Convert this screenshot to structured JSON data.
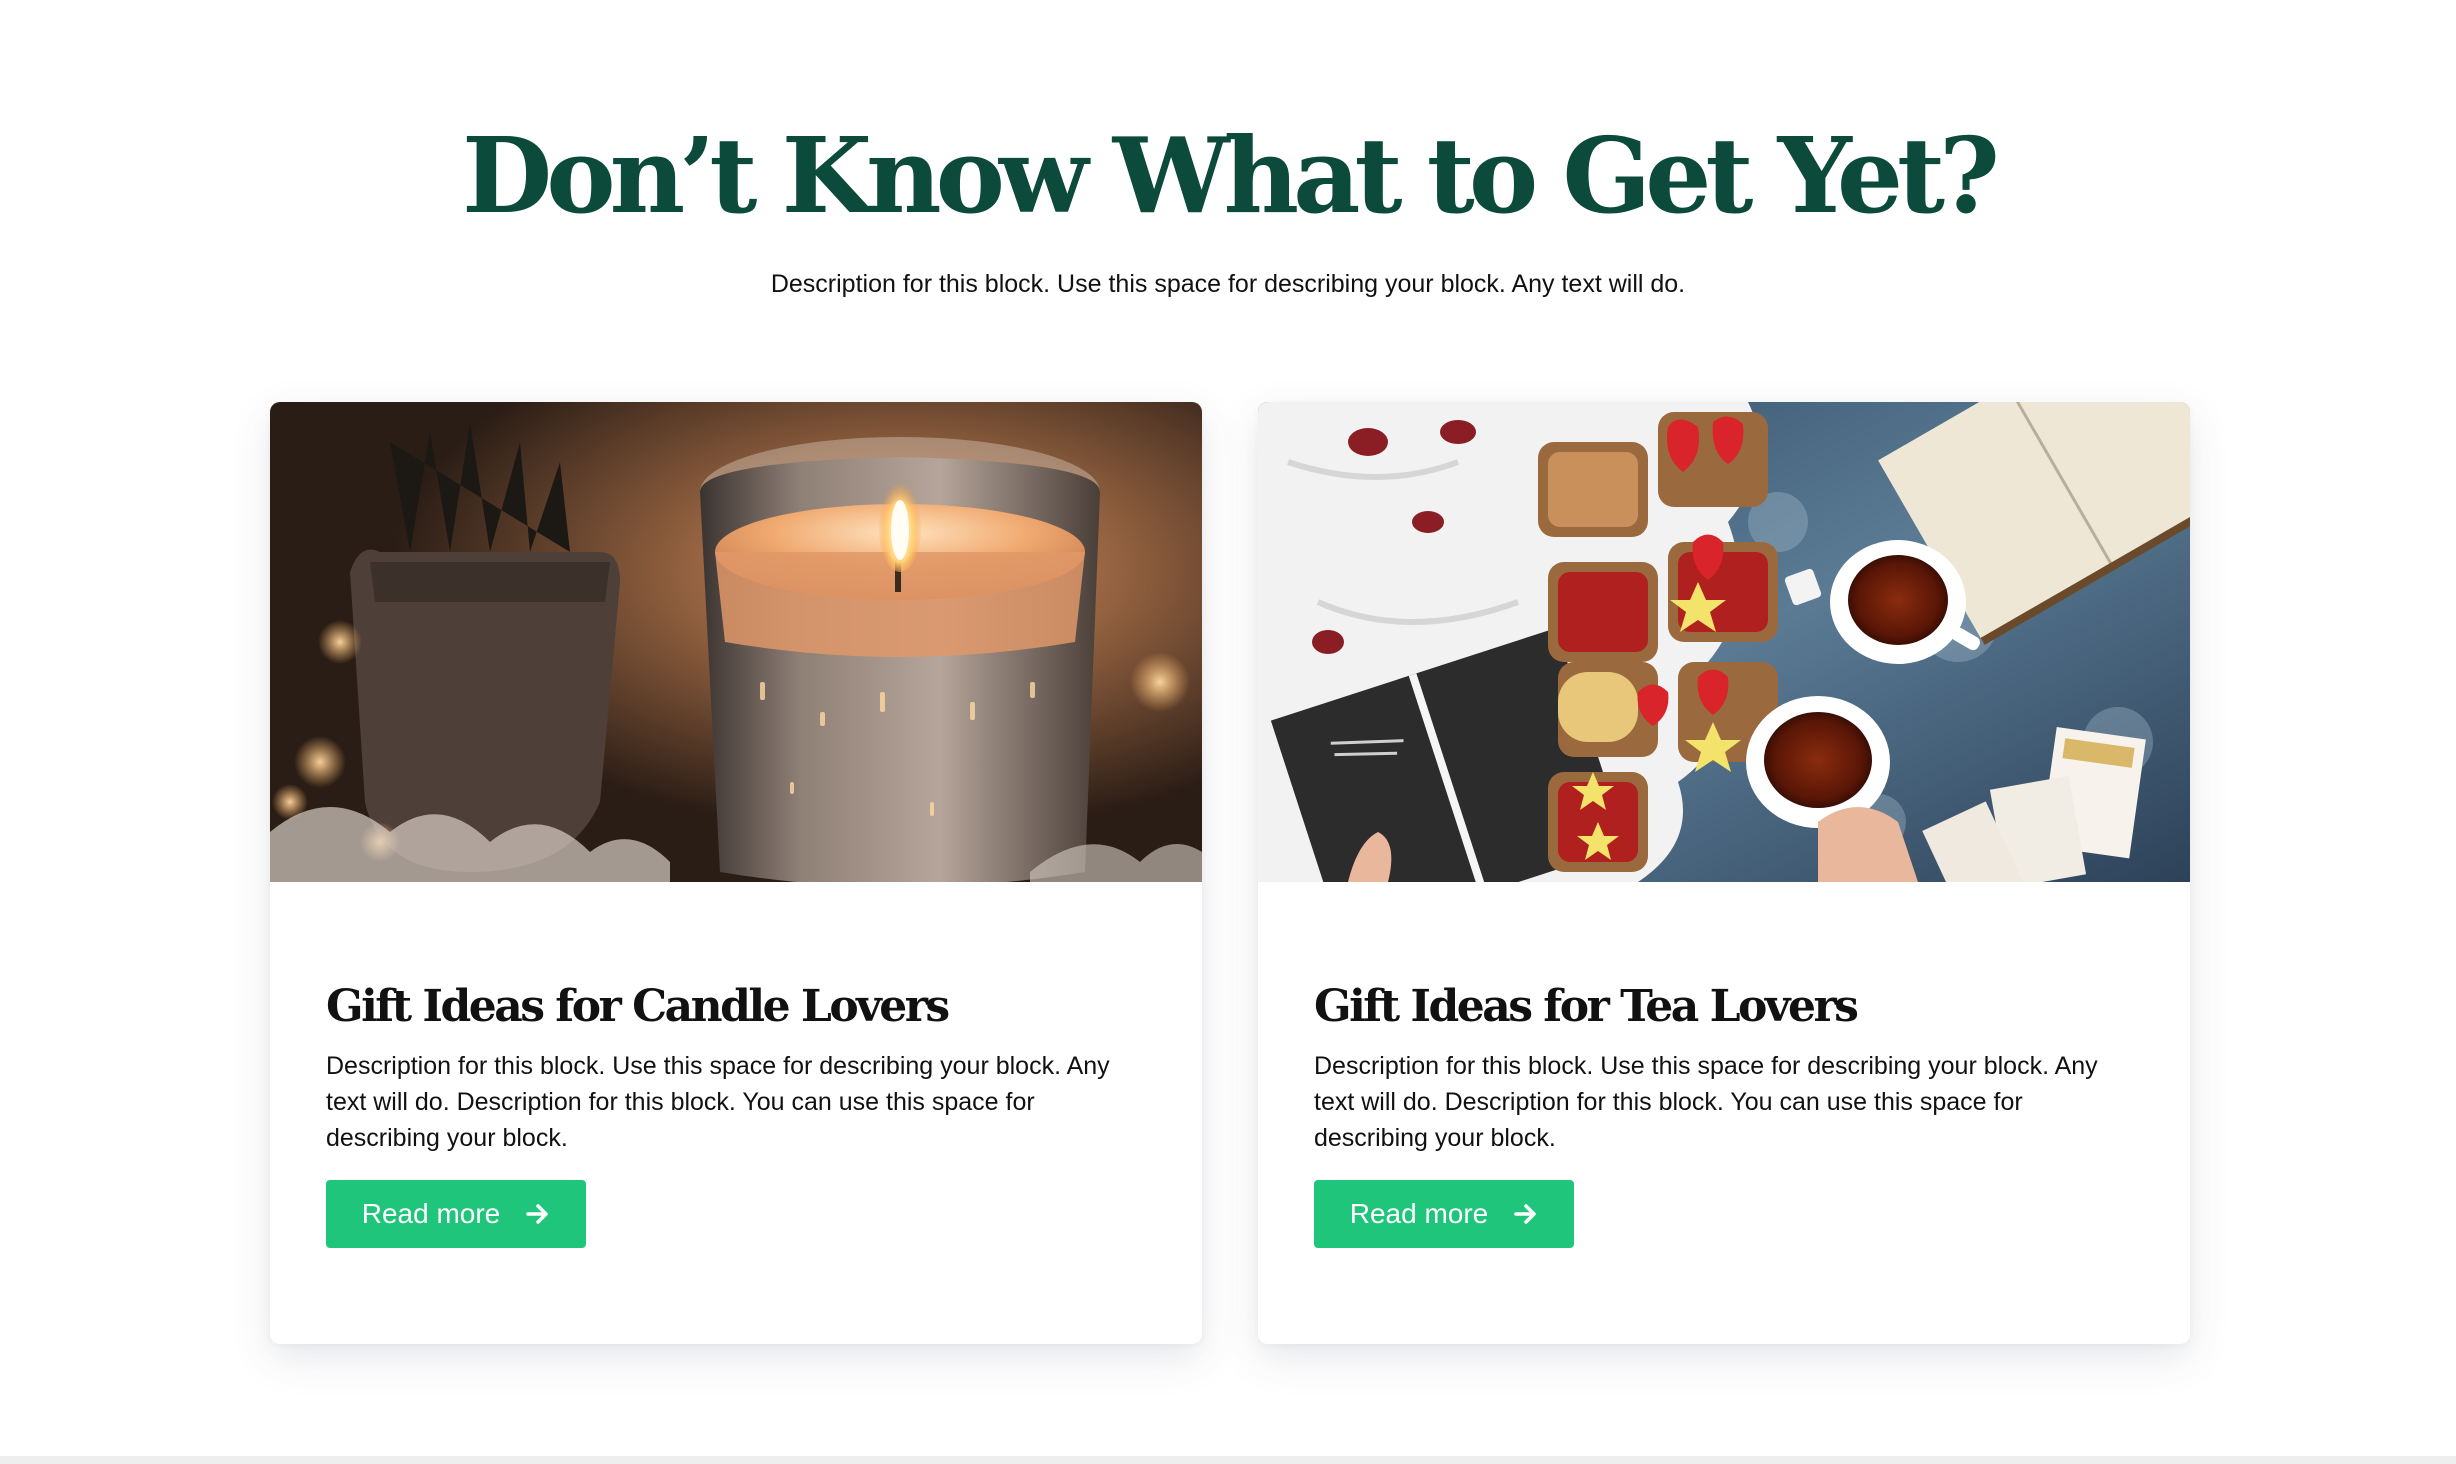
{
  "section": {
    "title": "Don’t Know What to Get Yet?",
    "description": "Description for this block. Use this space for describing your block. Any text will do."
  },
  "cards": [
    {
      "title": "Gift Ideas for Candle Lovers",
      "description": "Description for this block. Use this space for describing your block. Any text will do. Description for this block. You can use this space for describing your block.",
      "button_label": "Read more",
      "button_icon": "arrow-right-icon",
      "image": "lit-candle-photo"
    },
    {
      "title": "Gift Ideas for Tea Lovers",
      "description": "Description for this block. Use this space for describing your block. Any text will do. Description for this block. You can use this space for describing your block.",
      "button_label": "Read more",
      "button_icon": "arrow-right-icon",
      "image": "tea-and-toast-flatlay-photo"
    }
  ],
  "colors": {
    "heading": "#0c4a3c",
    "button": "#20c57c",
    "text": "#111111",
    "background": "#ffffff"
  }
}
